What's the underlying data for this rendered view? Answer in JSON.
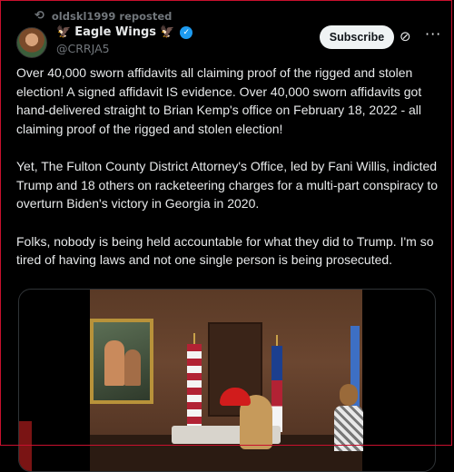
{
  "repost": {
    "icon": "repost-icon",
    "text": "oldskl1999 reposted"
  },
  "author": {
    "emoji": "🦅",
    "name": "Eagle Wings",
    "name_emoji": "🦅",
    "handle": "@CRRJA5",
    "verified_color": "#1d9bf0"
  },
  "actions": {
    "subscribe_label": "Subscribe",
    "grok_icon": "grok-icon",
    "more_icon": "more-icon",
    "more_glyph": "···"
  },
  "tweet": {
    "paragraphs": [
      "Over 40,000 sworn affidavits all claiming proof of the rigged and stolen election! A signed affidavit IS evidence. Over 40,000 sworn affidavits got hand-delivered straight to Brian Kemp's office on February 18, 2022 - all claiming proof of the rigged and stolen election!",
      "Yet, The Fulton County District Attorney's Office, led by Fani Willis, indicted Trump and 18 others on racketeering charges for a multi-part conspiracy to overturn Biden's victory in Georgia in 2020.",
      "Folks, nobody is being held accountable for what they did to Trump. I'm so tired of having laws and not one single person is being prosecuted."
    ]
  },
  "colors": {
    "background": "#000000",
    "text": "#e7e9ea",
    "muted": "#71767b",
    "border": "#2f3336",
    "frame": "#c8102e"
  }
}
